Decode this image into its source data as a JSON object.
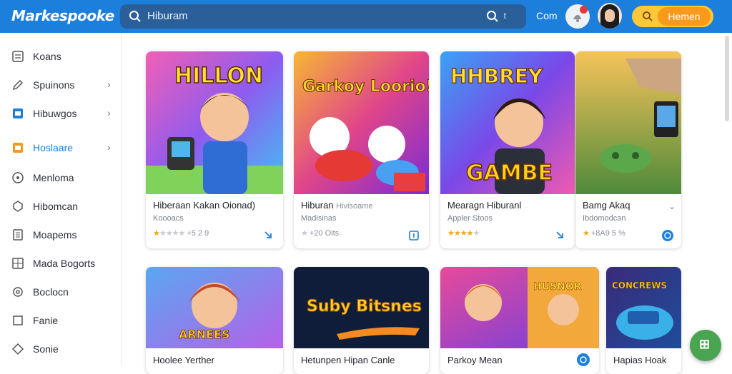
{
  "app": {
    "logo": "Markespooke"
  },
  "search": {
    "value": "Hiburam",
    "key_hint": "t"
  },
  "header": {
    "link": "Com",
    "action_button": "Hemen"
  },
  "colors": {
    "primary": "#1d7fdc",
    "accent_yellow": "#fdc73a",
    "accent_orange": "#fa9a1d",
    "star": "#f0a818",
    "fab": "#4aa452"
  },
  "sidebar": {
    "items": [
      {
        "label": "Koans",
        "icon": "list-icon"
      },
      {
        "label": "Spuinons",
        "icon": "pen-icon",
        "has_chevron": true
      },
      {
        "label": "Hibuwgos",
        "icon": "blue-square-icon",
        "has_chevron": true
      },
      {
        "label": "Hoslaare",
        "icon": "orange-square-icon",
        "has_chevron": true,
        "active": true
      },
      {
        "label": "Menloma",
        "icon": "circle-icon"
      },
      {
        "label": "Hibomcan",
        "icon": "puzzle-icon"
      },
      {
        "label": "Moapems",
        "icon": "doc-icon"
      },
      {
        "label": "Mada Bogorts",
        "icon": "grid-icon"
      },
      {
        "label": "Boclocn",
        "icon": "gear-icon"
      },
      {
        "label": "Fanie",
        "icon": "square-icon"
      },
      {
        "label": "Sonie",
        "icon": "diamond-icon"
      }
    ],
    "chevron": "›"
  },
  "cards": [
    {
      "title": "Hiberaan Kakan Oionad)",
      "subtitle": "Koooacs",
      "rating_text": "+5 2 9",
      "stars": 1,
      "thumb_text": "HILLON",
      "icon": "share-icon"
    },
    {
      "title": "Hiburan",
      "title_extra": "Hivisoame",
      "subtitle": "Madisinas",
      "rating_text": "+20 Oits",
      "stars": 1,
      "thumb_text": "Garkoy Loorio!",
      "icon": "box-icon"
    },
    {
      "title": "Mearagn Hiburanl",
      "subtitle": "Appler Stoos",
      "rating_text": "",
      "stars": 4,
      "thumb_text_top": "HHBREY",
      "thumb_text_bottom": "GAMBE",
      "icon": "share-icon"
    },
    {
      "title": "Bamg Akaq",
      "subtitle": "Ibdomodcan",
      "rating_text": "+8A9 5 %",
      "stars": 1,
      "icon": "globe-icon"
    },
    {
      "title": "Hoolee Yerther",
      "thumb_text": "ARNEES"
    },
    {
      "title": "Hetunpen Hipan Canle",
      "thumb_text": "Suby Bitsnes"
    },
    {
      "title": "Parkoy Mean",
      "thumb_text": "HUSNOR"
    },
    {
      "title": "Hapias Hoak",
      "thumb_text": "CONCREWS"
    }
  ]
}
